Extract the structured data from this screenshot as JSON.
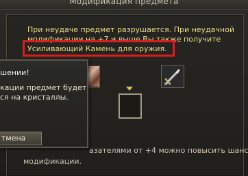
{
  "window": {
    "title": "Модификация предмета"
  },
  "info": {
    "lines": [
      "При неудаче предмет разрушается. При неудачной",
      "модификации на +7 и выше Вы также получите",
      "Усиливающий Камень для оружия."
    ]
  },
  "slots": {
    "left_item_icon": "armor-item-icon",
    "right_item_icon": "sword-icon",
    "arrow_icon": "arrow-down-icon"
  },
  "bottom": {
    "lines": [
      "азателями от +4 можно повысить шанс",
      "модификации."
    ]
  },
  "dialog": {
    "title": "шении!",
    "message_lines": [
      "кации предмет будет",
      "ся на кристаллы."
    ],
    "cancel_label": "тмена"
  },
  "colors": {
    "info_text": "#e8dc86",
    "highlight": "#e01b1b",
    "body_text": "#c9c4b4"
  }
}
